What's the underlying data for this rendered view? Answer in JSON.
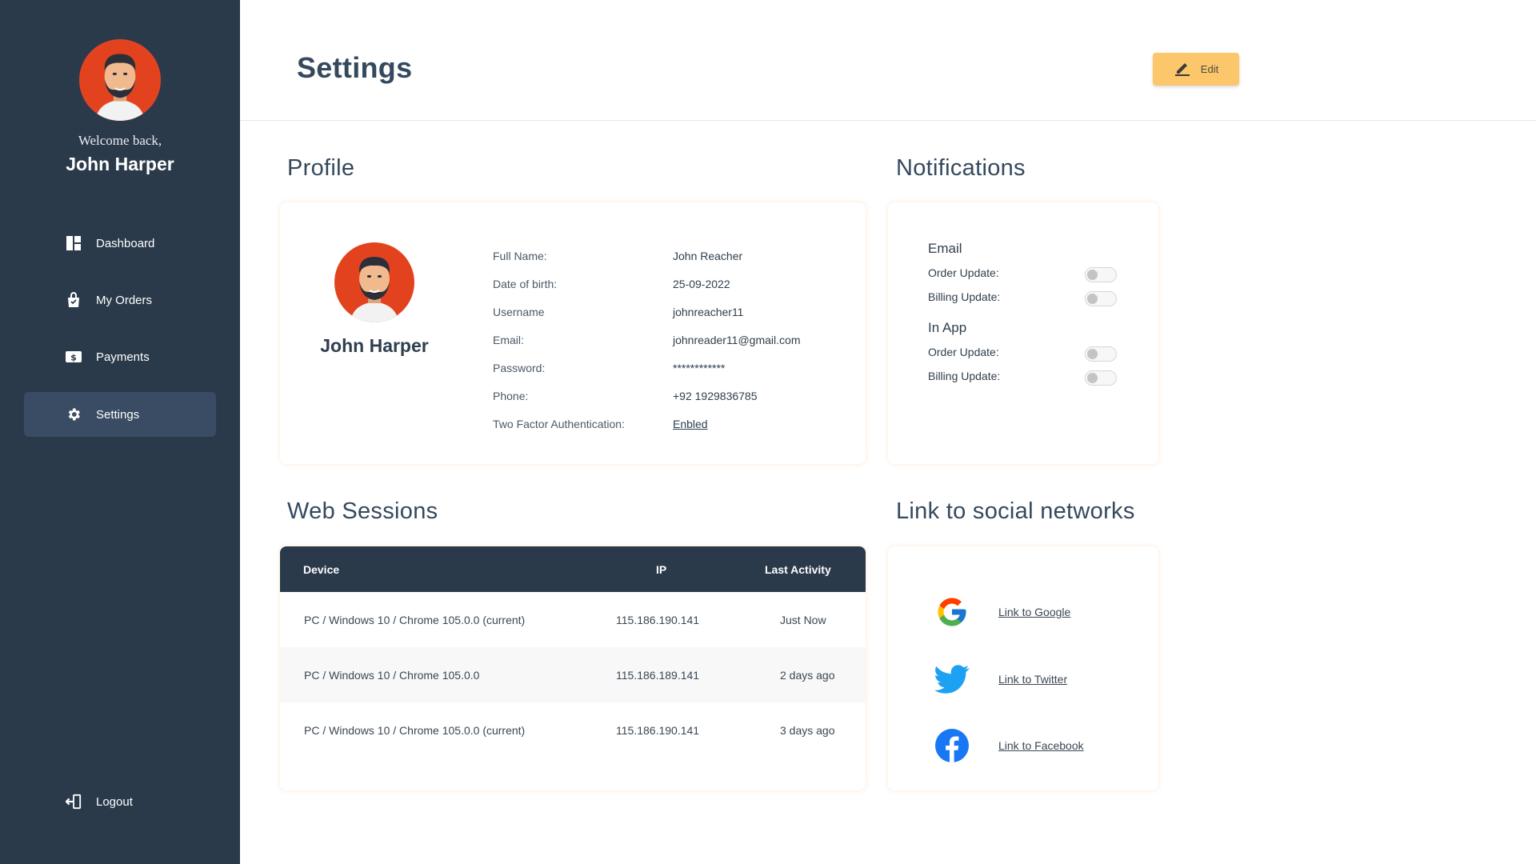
{
  "sidebar": {
    "welcome": "Welcome back,",
    "name": "John Harper",
    "items": [
      {
        "label": "Dashboard",
        "icon": "dashboard-icon"
      },
      {
        "label": "My Orders",
        "icon": "shopping-bag-icon"
      },
      {
        "label": "Payments",
        "icon": "dollar-bill-icon"
      },
      {
        "label": "Settings",
        "icon": "gear-icon",
        "active": true
      }
    ],
    "logout": {
      "label": "Logout",
      "icon": "logout-icon"
    }
  },
  "header": {
    "title": "Settings",
    "edit_label": "Edit"
  },
  "profile": {
    "section_title": "Profile",
    "name": "John Harper",
    "fields": [
      {
        "label": "Full Name:",
        "value": "John Reacher"
      },
      {
        "label": "Date of birth:",
        "value": "25-09-2022"
      },
      {
        "label": "Username",
        "value": "johnreacher11"
      },
      {
        "label": "Email:",
        "value": "johnreader11@gmail.com"
      },
      {
        "label": "Password:",
        "value": "************"
      },
      {
        "label": "Phone:",
        "value": "+92 1929836785"
      },
      {
        "label": "Two Factor Authentication:",
        "value": "Enbled"
      }
    ]
  },
  "notifications": {
    "section_title": "Notifications",
    "groups": [
      {
        "title": "Email",
        "items": [
          {
            "label": "Order Update:",
            "on": false
          },
          {
            "label": "Billing Update:",
            "on": false
          }
        ]
      },
      {
        "title": "In App",
        "items": [
          {
            "label": "Order Update:",
            "on": false
          },
          {
            "label": "Billing Update:",
            "on": false
          }
        ]
      }
    ]
  },
  "sessions": {
    "section_title": "Web Sessions",
    "columns": [
      "Device",
      "IP",
      "Last Activity"
    ],
    "rows": [
      [
        "PC / Windows 10 / Chrome 105.0.0 (current)",
        "115.186.190.141",
        "Just Now"
      ],
      [
        "PC / Windows 10 / Chrome 105.0.0",
        "115.186.189.141",
        "2 days ago"
      ],
      [
        "PC / Windows 10 / Chrome 105.0.0 (current)",
        "115.186.190.141",
        "3 days ago"
      ]
    ]
  },
  "social": {
    "section_title": "Link to social networks",
    "links": [
      {
        "label": "Link to Google",
        "icon": "google-icon"
      },
      {
        "label": "Link to Twitter",
        "icon": "twitter-icon"
      },
      {
        "label": "Link to Facebook",
        "icon": "facebook-icon"
      }
    ]
  },
  "colors": {
    "sidebar": "#2b3a4b",
    "accent": "#fcc76a",
    "avatar_bg": "#e2431e",
    "title": "#34495e"
  }
}
